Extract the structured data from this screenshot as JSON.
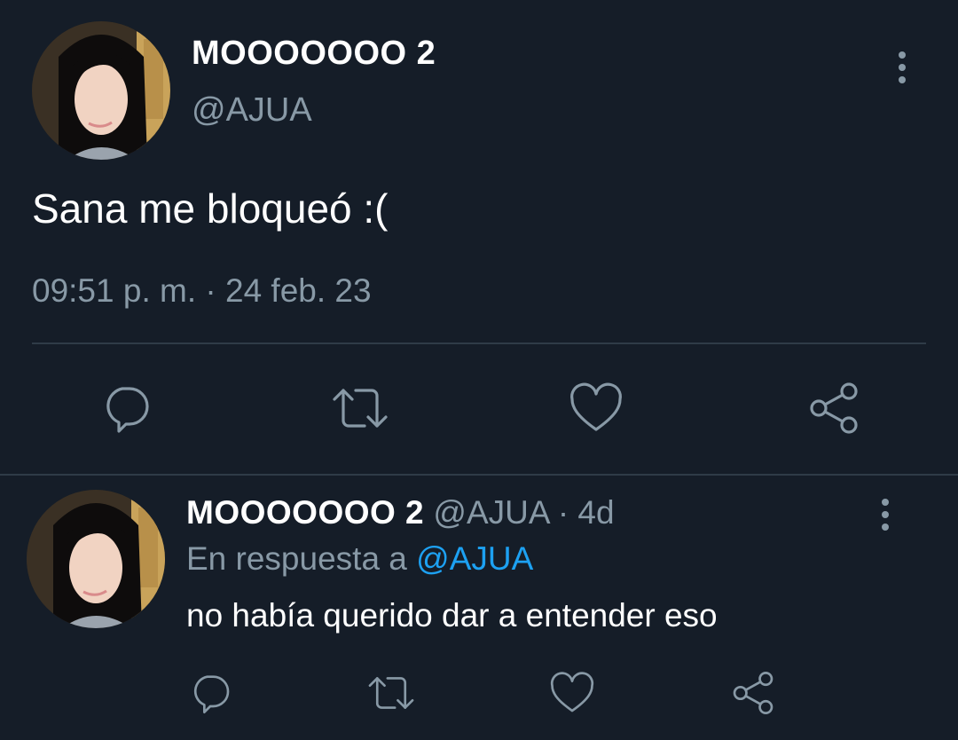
{
  "main_tweet": {
    "display_name": "MOOOOOOO 2",
    "handle": "@AJUA",
    "text": "Sana me bloqueó :(",
    "timestamp": "09:51 p. m. · 24 feb. 23",
    "actions": [
      "reply-icon",
      "retweet-icon",
      "like-icon",
      "share-icon"
    ]
  },
  "reply_tweet": {
    "display_name": "MOOOOOOO 2",
    "handle": "@AJUA",
    "age": "· 4d",
    "reply_prefix": "En respuesta a",
    "reply_to": "@AJUA",
    "text": "no había querido dar a entender eso",
    "actions": [
      "reply-icon",
      "retweet-icon",
      "like-icon",
      "share-icon"
    ]
  },
  "colors": {
    "background": "#151d28",
    "muted_text": "#8899a6",
    "link": "#1da1f2",
    "divider": "#2f3b47"
  }
}
